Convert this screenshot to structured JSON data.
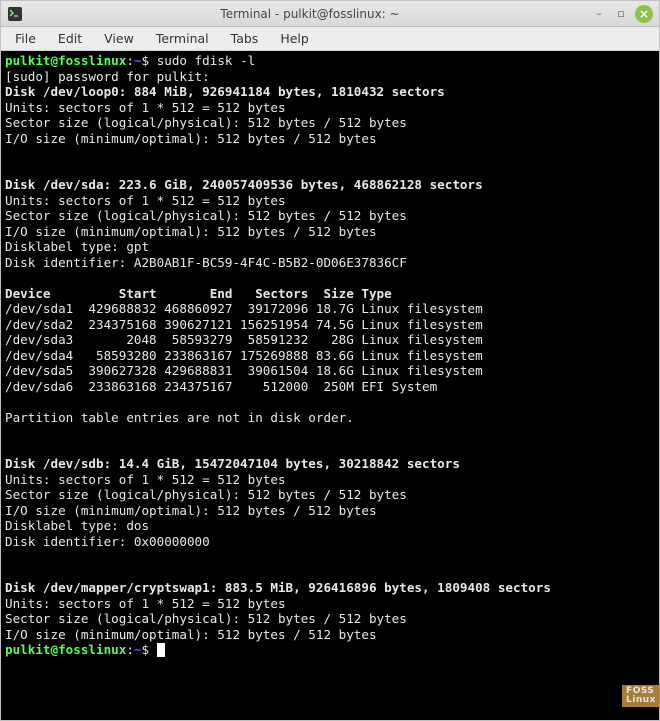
{
  "window": {
    "title": "Terminal - pulkit@fosslinux: ~",
    "controls": {
      "min": "–",
      "max": "▫",
      "close": "×"
    }
  },
  "menubar": {
    "items": [
      "File",
      "Edit",
      "View",
      "Terminal",
      "Tabs",
      "Help"
    ]
  },
  "prompt": {
    "user": "pulkit@fosslinux",
    "sep": ":",
    "path": "~",
    "suffix": "$ "
  },
  "lines": {
    "cmd1": "sudo fdisk -l",
    "sudo_pw": "[sudo] password for pulkit:",
    "loop0_hdr": "Disk /dev/loop0: 884 MiB, 926941184 bytes, 1810432 sectors",
    "units": "Units: sectors of 1 * 512 = 512 bytes",
    "sector": "Sector size (logical/physical): 512 bytes / 512 bytes",
    "io": "I/O size (minimum/optimal): 512 bytes / 512 bytes",
    "sda_hdr": "Disk /dev/sda: 223.6 GiB, 240057409536 bytes, 468862128 sectors",
    "label_gpt": "Disklabel type: gpt",
    "sda_id": "Disk identifier: A2B0AB1F-BC59-4F4C-B5B2-0D06E37836CF",
    "part_hdr": "Device         Start       End   Sectors  Size Type",
    "sda1": "/dev/sda1  429688832 468860927  39172096 18.7G Linux filesystem",
    "sda2": "/dev/sda2  234375168 390627121 156251954 74.5G Linux filesystem",
    "sda3": "/dev/sda3       2048  58593279  58591232   28G Linux filesystem",
    "sda4": "/dev/sda4   58593280 233863167 175269888 83.6G Linux filesystem",
    "sda5": "/dev/sda5  390627328 429688831  39061504 18.6G Linux filesystem",
    "sda6": "/dev/sda6  233863168 234375167    512000  250M EFI System",
    "not_in_order": "Partition table entries are not in disk order.",
    "sdb_hdr": "Disk /dev/sdb: 14.4 GiB, 15472047104 bytes, 30218842 sectors",
    "label_dos": "Disklabel type: dos",
    "sdb_id": "Disk identifier: 0x00000000",
    "crypt_hdr": "Disk /dev/mapper/cryptswap1: 883.5 MiB, 926416896 bytes, 1809408 sectors"
  },
  "watermark": {
    "l1": "FOSS",
    "l2": "Linux"
  }
}
